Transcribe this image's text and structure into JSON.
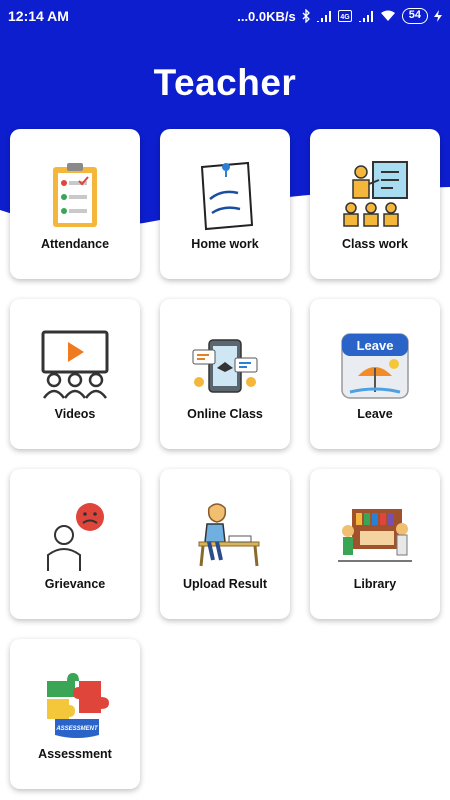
{
  "status_bar": {
    "time": "12:14 AM",
    "network_speed": "...0.0KB/s",
    "battery": "54"
  },
  "header": {
    "title": "Teacher"
  },
  "tiles": [
    {
      "label": "Attendance",
      "icon": "attendance-clipboard-icon"
    },
    {
      "label": "Home work",
      "icon": "homework-note-icon"
    },
    {
      "label": "Class work",
      "icon": "classroom-teacher-icon"
    },
    {
      "label": "Videos",
      "icon": "video-audience-icon"
    },
    {
      "label": "Online Class",
      "icon": "online-class-tablet-icon"
    },
    {
      "label": "Leave",
      "icon": "leave-calendar-icon"
    },
    {
      "label": "Grievance",
      "icon": "grievance-person-icon"
    },
    {
      "label": "Upload Result",
      "icon": "student-writing-icon"
    },
    {
      "label": "Library",
      "icon": "library-scene-icon"
    },
    {
      "label": "Assessment",
      "icon": "assessment-puzzle-icon"
    }
  ],
  "colors": {
    "header_blue": "#0d1ecf",
    "card_bg": "#ffffff"
  }
}
